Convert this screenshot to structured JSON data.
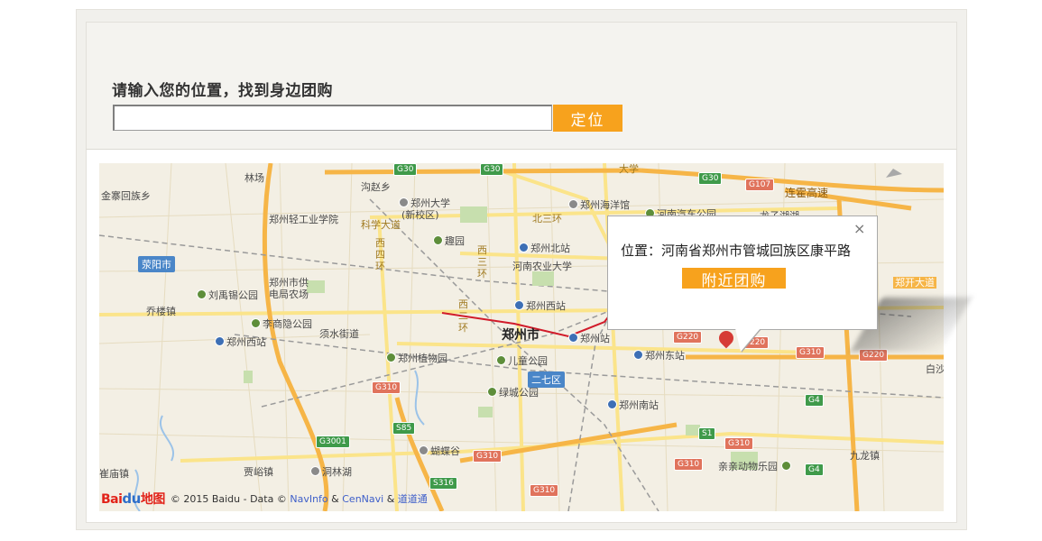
{
  "search": {
    "prompt": "请输入您的位置，找到身边团购",
    "input_value": "",
    "locate_label": "定位"
  },
  "popup": {
    "address": "位置：河南省郑州市管城回族区康平路",
    "close_glyph": "×",
    "nearby_label": "附近团购"
  },
  "map": {
    "labels": {
      "linchang": "林场",
      "goudao": "沟赵乡",
      "zzdx": "郑州大学",
      "zzdx_sub": "(新校区)",
      "zzhyg": "郑州海洋馆",
      "hnqc": "河南汽车公园",
      "longzi": "龙子湖湖",
      "jinzhai": "金寨回族乡",
      "qingong": "郑州轻工业学院",
      "kexue": "科学大道",
      "qiyuan": "趣园",
      "zzbz": "郑州北站",
      "hnny": "河南农业大学",
      "beisan": "北三环",
      "xisihuan": "西四环",
      "xisanhuan": "西三环",
      "xierhuan": "西二环",
      "xingyang": "荥阳市",
      "liuyuxi": "刘禹锡公园",
      "gongdian": "郑州市供",
      "gongdian2": "电局农场",
      "qiaolou": "乔楼镇",
      "lishangyin": "李商隐公园",
      "zzxz": "郑州西站",
      "xushui": "须水街道",
      "zzxizhan": "郑州西站",
      "zzs": "郑州市",
      "zzz": "郑州站",
      "zzzwy": "郑州植物园",
      "ertong": "儿童公园",
      "erqi": "二七区",
      "zzdz": "郑州东站",
      "lvcheng": "绿城公园",
      "zznz": "郑州南站",
      "hudie": "蝴蝶谷",
      "cuimiao": "崔庙镇",
      "jiayu": "贾峪镇",
      "donglinhu": "洞林湖",
      "qinqin": "亲亲动物乐园",
      "jiulong": "九龙镇",
      "baisha": "白沙",
      "lianhuo": "连霍高速",
      "zhengkai": "郑开大道",
      "daxue": "大学"
    },
    "shields": {
      "g30a": "G30",
      "g30b": "G30",
      "g30c": "G30",
      "g107": "G107",
      "g220a": "G220",
      "g220b": "G220",
      "g220c": "G220",
      "g310a": "G310",
      "g310b": "G310",
      "g310c": "G310",
      "g310d": "G310",
      "g310e": "G310",
      "g310f": "G310",
      "g4a": "G4",
      "g4b": "G4",
      "s85": "S85",
      "s1": "S1",
      "s316": "S316",
      "g3001": "G3001"
    },
    "attribution": {
      "logo_text": "Bai",
      "logo_paw": "du",
      "logo_suffix": "地图",
      "copyright": "© 2015 Baidu - Data ©",
      "navinfo": "NavInfo",
      "amp1": "&",
      "cennavi": "CenNavi",
      "amp2": "&",
      "daodao": "道道通"
    }
  },
  "colors": {
    "accent": "#f7a21d",
    "panel": "#f4f3ef",
    "map_bg": "#f3efe4"
  }
}
